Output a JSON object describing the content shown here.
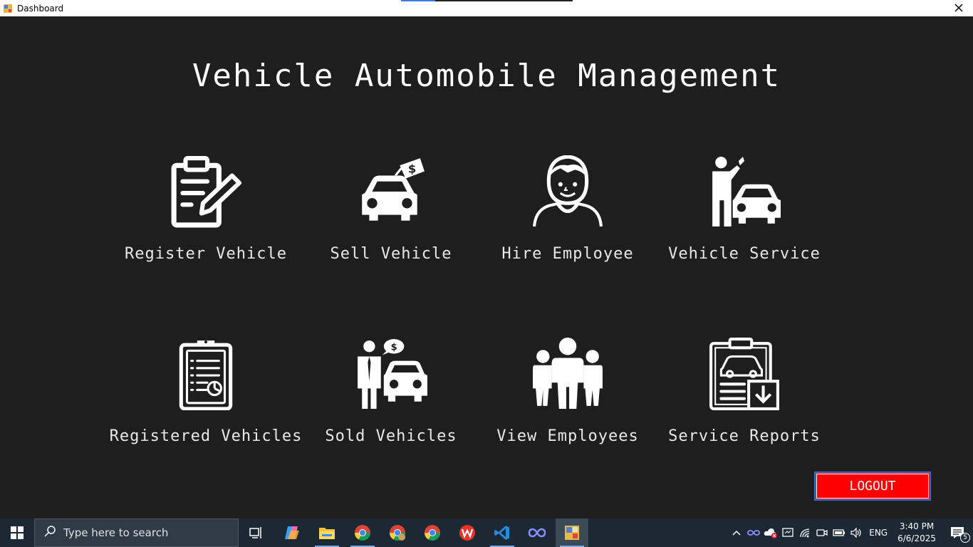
{
  "window": {
    "title": "Dashboard"
  },
  "heading": "Vehicle Automobile Management",
  "tiles": [
    {
      "label": "Register Vehicle",
      "icon": "clipboard-pen-icon"
    },
    {
      "label": "Sell Vehicle",
      "icon": "car-price-tag-icon"
    },
    {
      "label": "Hire Employee",
      "icon": "employee-person-icon"
    },
    {
      "label": "Vehicle Service",
      "icon": "mechanic-car-icon"
    },
    {
      "label": "Registered Vehicles",
      "icon": "report-clipboard-icon"
    },
    {
      "label": "Sold Vehicles",
      "icon": "dealer-car-icon"
    },
    {
      "label": "View Employees",
      "icon": "group-people-icon"
    },
    {
      "label": "Service Reports",
      "icon": "car-report-download-icon"
    }
  ],
  "logout_label": "LOGOUT",
  "taskbar": {
    "search_placeholder": "Type here to search",
    "language": "ENG",
    "time": "3:40 PM",
    "date": "6/6/2025",
    "notification_count": "5"
  },
  "colors": {
    "background": "#1e1e1e",
    "logout": "#ff0000",
    "taskbar": "#1c2833"
  }
}
